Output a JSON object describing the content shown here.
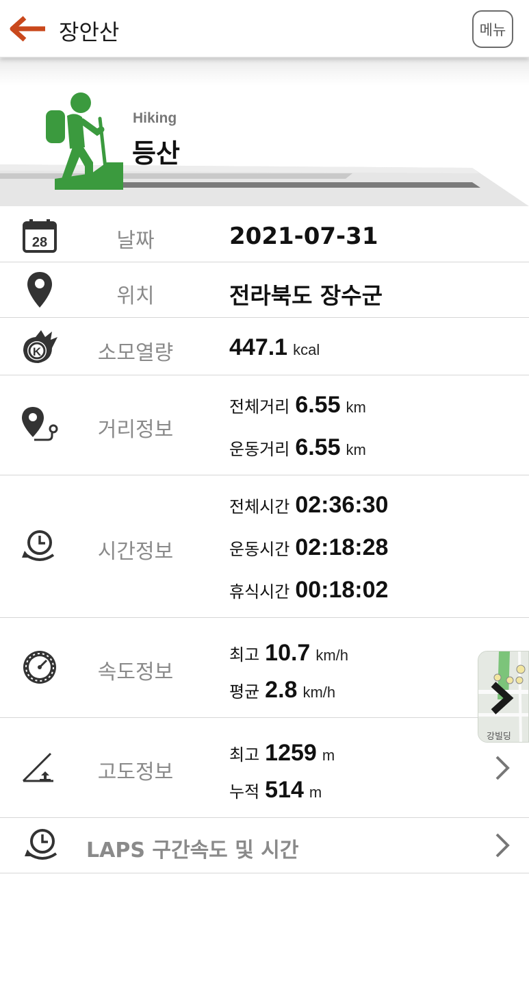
{
  "header": {
    "title": "장안산",
    "menu_label": "메뉴",
    "back_icon": "arrow-left-icon",
    "accent_color": "#c9481c"
  },
  "hero": {
    "activity_en": "Hiking",
    "activity_ko": "등산",
    "icon": "hiker-icon",
    "icon_color": "#3b9a3e"
  },
  "rows": {
    "date": {
      "icon": "calendar-icon",
      "icon_text": "28",
      "label": "날짜",
      "value": "2021-07-31"
    },
    "location": {
      "icon": "location-pin-icon",
      "label": "위치",
      "value": "전라북도 장수군"
    },
    "calories": {
      "icon": "calorie-flame-icon",
      "label": "소모열량",
      "value": "447.1",
      "unit": "kcal"
    },
    "distance": {
      "icon": "route-pin-icon",
      "label": "거리정보",
      "lines": [
        {
          "name": "전체거리",
          "value": "6.55",
          "unit": "km"
        },
        {
          "name": "운동거리",
          "value": "6.55",
          "unit": "km"
        }
      ]
    },
    "time": {
      "icon": "clock-cycle-icon",
      "label": "시간정보",
      "lines": [
        {
          "name": "전체시간",
          "value": "02:36:30"
        },
        {
          "name": "운동시간",
          "value": "02:18:28"
        },
        {
          "name": "휴식시간",
          "value": "00:18:02"
        }
      ]
    },
    "speed": {
      "icon": "speedometer-icon",
      "label": "속도정보",
      "lines": [
        {
          "name": "최고",
          "value": "10.7",
          "unit": "km/h"
        },
        {
          "name": "평균",
          "value": "2.8",
          "unit": "km/h"
        }
      ]
    },
    "altitude": {
      "icon": "altitude-slope-icon",
      "label": "고도정보",
      "lines": [
        {
          "name": "최고",
          "value": "1259",
          "unit": "m"
        },
        {
          "name": "누적",
          "value": "514",
          "unit": "m"
        }
      ]
    },
    "laps": {
      "icon": "clock-cycle-icon",
      "label": "LAPS 구간속도 및 시간"
    }
  },
  "map_thumb": {
    "icon": "map-thumbnail-icon",
    "text": "강빌딩"
  }
}
